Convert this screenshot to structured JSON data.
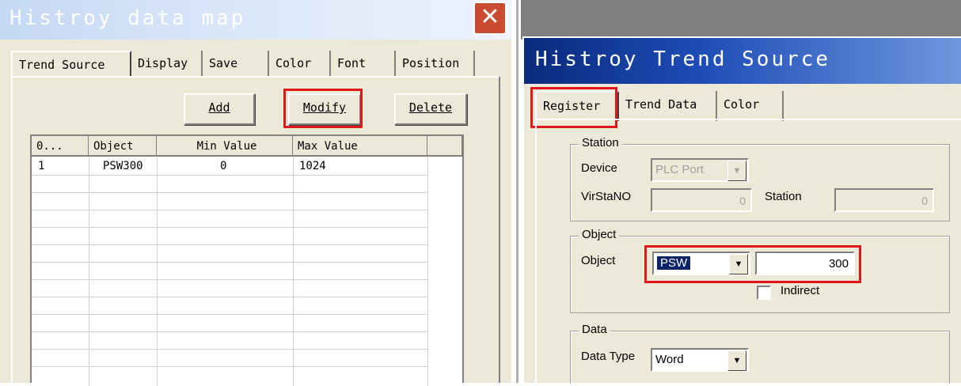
{
  "left": {
    "title": "Histroy data map",
    "close_glyph": "✕",
    "tabs": [
      "Trend Source",
      "Display",
      "Save",
      "Color",
      "Font",
      "Position"
    ],
    "buttons": {
      "add": "Add",
      "modify": "Modify",
      "delete": "Delete"
    },
    "columns": [
      "0...",
      "Object",
      "Min Value",
      "Max Value"
    ],
    "rows": [
      {
        "no": "1",
        "object": "PSW300",
        "min": "0",
        "max": "1024"
      }
    ]
  },
  "right": {
    "title": "Histroy Trend Source",
    "tabs": [
      "Register",
      "Trend Data",
      "Color"
    ],
    "station": {
      "group_label": "Station",
      "device_label": "Device",
      "device_value": "PLC Port",
      "virstano_label": "VirStaNO",
      "virstano_value": "0",
      "station_label": "Station",
      "station_value": "0"
    },
    "object": {
      "group_label": "Object",
      "object_label": "Object",
      "object_type": "PSW",
      "object_address": "300",
      "indirect_label": "Indirect"
    },
    "data": {
      "group_label": "Data",
      "data_type_label": "Data Type",
      "data_type_value": "Word"
    }
  },
  "icons": {
    "dropdown_arrow": "▼"
  },
  "colors": {
    "highlight": "#e0161b",
    "right_title_bg": "#1d4cb6",
    "selection": "#0a246a"
  }
}
